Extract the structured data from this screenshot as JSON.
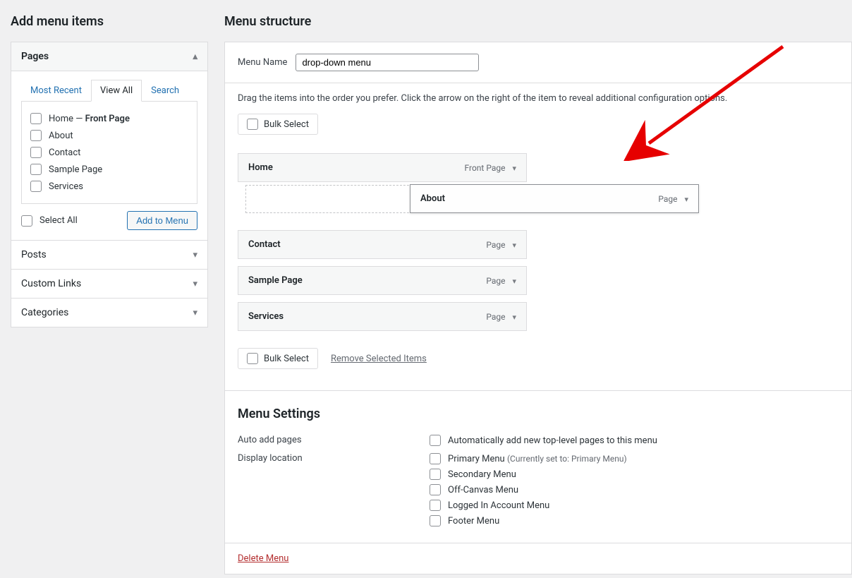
{
  "left": {
    "title": "Add menu items",
    "accordion": {
      "pages_head": "Pages",
      "tabs": {
        "recent": "Most Recent",
        "view_all": "View All",
        "search": "Search"
      },
      "pages": [
        {
          "label": "Home — ",
          "suffix": "Front Page"
        },
        {
          "label": "About",
          "suffix": ""
        },
        {
          "label": "Contact",
          "suffix": ""
        },
        {
          "label": "Sample Page",
          "suffix": ""
        },
        {
          "label": "Services",
          "suffix": ""
        }
      ],
      "select_all": "Select All",
      "add_to_menu": "Add to Menu",
      "posts_head": "Posts",
      "custom_links_head": "Custom Links",
      "categories_head": "Categories"
    }
  },
  "right": {
    "title": "Menu structure",
    "menu_name_label": "Menu Name",
    "menu_name_value": "drop-down menu",
    "instructions": "Drag the items into the order you prefer. Click the arrow on the right of the item to reveal additional configuration options.",
    "bulk_select": "Bulk Select",
    "items": [
      {
        "title": "Home",
        "type": "Front Page"
      },
      {
        "title": "About",
        "type": "Page"
      },
      {
        "title": "Contact",
        "type": "Page"
      },
      {
        "title": "Sample Page",
        "type": "Page"
      },
      {
        "title": "Services",
        "type": "Page"
      }
    ],
    "remove_selected": "Remove Selected Items",
    "settings_title": "Menu Settings",
    "auto_add_label": "Auto add pages",
    "auto_add_opt": "Automatically add new top-level pages to this menu",
    "display_loc_label": "Display location",
    "locations": [
      {
        "label": "Primary Menu ",
        "hint": "(Currently set to: Primary Menu)"
      },
      {
        "label": "Secondary Menu",
        "hint": ""
      },
      {
        "label": "Off-Canvas Menu",
        "hint": ""
      },
      {
        "label": "Logged In Account Menu",
        "hint": ""
      },
      {
        "label": "Footer Menu",
        "hint": ""
      }
    ],
    "delete_menu": "Delete Menu"
  }
}
